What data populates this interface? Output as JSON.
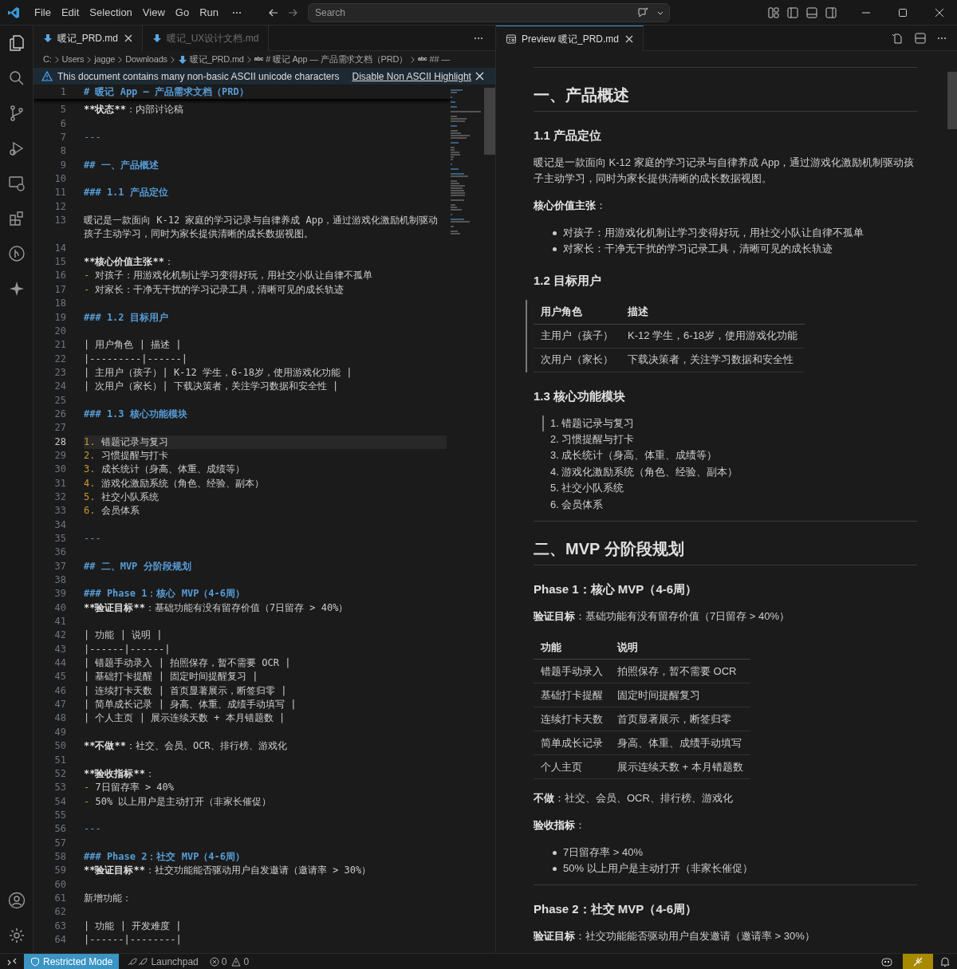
{
  "window": {
    "menu": [
      "File",
      "Edit",
      "Selection",
      "View",
      "Go",
      "Run"
    ],
    "search": {
      "placeholder": "Search"
    }
  },
  "left_group": {
    "tabs": [
      {
        "label": "暖记_PRD.md",
        "selected": true
      },
      {
        "label": "暖记_UX设计文档.md",
        "selected": false
      }
    ],
    "breadcrumbs": [
      {
        "text": "C:",
        "kind": "folder"
      },
      {
        "text": "Users",
        "kind": "folder"
      },
      {
        "text": "jagge",
        "kind": "folder"
      },
      {
        "text": "Downloads",
        "kind": "folder"
      },
      {
        "text": "暖记_PRD.md",
        "kind": "file"
      },
      {
        "text": "# 暖记 App — 产品需求文档（PRD）",
        "kind": "symbol",
        "icon_text": "abc"
      },
      {
        "text": "## —",
        "kind": "symbol",
        "icon_text": "abc"
      }
    ],
    "banner": {
      "message": "This document contains many non-basic ASCII unicode characters",
      "action": "Disable Non ASCII Highlight"
    },
    "lines": [
      {
        "n": "1",
        "kind": "heading",
        "text": "# 暖记 App — 产品需求文档（PRD）",
        "current": false
      },
      {
        "n": "5",
        "kind": "strong",
        "lead": "**状态**",
        "text": "：内部讨论稿",
        "current": false
      },
      {
        "n": "6",
        "kind": "blank",
        "current": false
      },
      {
        "n": "7",
        "kind": "hr",
        "text": "---",
        "current": false
      },
      {
        "n": "8",
        "kind": "blank",
        "current": false
      },
      {
        "n": "9",
        "kind": "heading",
        "text": "## 一、产品概述",
        "current": false
      },
      {
        "n": "10",
        "kind": "blank",
        "current": false
      },
      {
        "n": "11",
        "kind": "heading",
        "text": "### 1.1 产品定位",
        "current": false
      },
      {
        "n": "12",
        "kind": "blank",
        "current": false
      },
      {
        "n": "13",
        "kind": "text",
        "text": "暖记是一款面向 K-12 家庭的学习记录与自律养成 App，通过游戏化激励机制驱动孩子主动学习，同时为家长提供清晰的成长数据视图。",
        "current": false
      },
      {
        "n": "14",
        "kind": "blank",
        "current": false
      },
      {
        "n": "15",
        "kind": "strong",
        "lead": "**核心价值主张**",
        "text": "：",
        "current": false
      },
      {
        "n": "16",
        "kind": "list",
        "marker": "-",
        "text": "对孩子：用游戏化机制让学习变得好玩，用社交小队让自律不孤单",
        "current": false
      },
      {
        "n": "17",
        "kind": "list",
        "marker": "-",
        "text": "对家长：干净无干扰的学习记录工具，清晰可见的成长轨迹",
        "current": false
      },
      {
        "n": "18",
        "kind": "blank",
        "current": false
      },
      {
        "n": "19",
        "kind": "heading",
        "text": "### 1.2 目标用户",
        "current": false
      },
      {
        "n": "20",
        "kind": "blank",
        "current": false
      },
      {
        "n": "21",
        "kind": "text",
        "text": "| 用户角色 | 描述 |",
        "current": false
      },
      {
        "n": "22",
        "kind": "text",
        "text": "|---------|------|",
        "current": false
      },
      {
        "n": "23",
        "kind": "text",
        "text": "| 主用户（孩子）| K-12 学生，6-18岁，使用游戏化功能 |",
        "current": false
      },
      {
        "n": "24",
        "kind": "text",
        "text": "| 次用户（家长）| 下载决策者，关注学习数据和安全性 |",
        "current": false
      },
      {
        "n": "25",
        "kind": "blank",
        "current": false
      },
      {
        "n": "26",
        "kind": "heading",
        "text": "### 1.3 核心功能模块",
        "current": false
      },
      {
        "n": "27",
        "kind": "blank",
        "current": false
      },
      {
        "n": "28",
        "kind": "list",
        "marker": "1.",
        "text": "错题记录与复习",
        "current": true
      },
      {
        "n": "29",
        "kind": "list",
        "marker": "2.",
        "text": "习惯提醒与打卡",
        "current": false
      },
      {
        "n": "30",
        "kind": "list",
        "marker": "3.",
        "text": "成长统计（身高、体重、成绩等）",
        "current": false
      },
      {
        "n": "31",
        "kind": "list",
        "marker": "4.",
        "text": "游戏化激励系统（角色、经验、副本）",
        "current": false
      },
      {
        "n": "32",
        "kind": "list",
        "marker": "5.",
        "text": "社交小队系统",
        "current": false
      },
      {
        "n": "33",
        "kind": "list",
        "marker": "6.",
        "text": "会员体系",
        "current": false
      },
      {
        "n": "34",
        "kind": "blank",
        "current": false
      },
      {
        "n": "35",
        "kind": "hr",
        "text": "---",
        "current": false
      },
      {
        "n": "36",
        "kind": "blank",
        "current": false
      },
      {
        "n": "37",
        "kind": "heading",
        "text": "## 二、MVP 分阶段规划",
        "current": false
      },
      {
        "n": "38",
        "kind": "blank",
        "current": false
      },
      {
        "n": "39",
        "kind": "heading",
        "text": "### Phase 1：核心 MVP（4-6周）",
        "current": false
      },
      {
        "n": "40",
        "kind": "strong",
        "lead": "**验证目标**",
        "text": "：基础功能有没有留存价值（7日留存 > 40%）",
        "current": false
      },
      {
        "n": "41",
        "kind": "blank",
        "current": false
      },
      {
        "n": "42",
        "kind": "text",
        "text": "| 功能 | 说明 |",
        "current": false
      },
      {
        "n": "43",
        "kind": "text",
        "text": "|------|------|",
        "current": false
      },
      {
        "n": "44",
        "kind": "text",
        "text": "| 错题手动录入 | 拍照保存，暂不需要 OCR |",
        "current": false
      },
      {
        "n": "45",
        "kind": "text",
        "text": "| 基础打卡提醒 | 固定时间提醒复习 |",
        "current": false
      },
      {
        "n": "46",
        "kind": "text",
        "text": "| 连续打卡天数 | 首页显著展示，断签归零 |",
        "current": false
      },
      {
        "n": "47",
        "kind": "text",
        "text": "| 简单成长记录 | 身高、体重、成绩手动填写 |",
        "current": false
      },
      {
        "n": "48",
        "kind": "text",
        "text": "| 个人主页 | 展示连续天数 + 本月错题数 |",
        "current": false
      },
      {
        "n": "49",
        "kind": "blank",
        "current": false
      },
      {
        "n": "50",
        "kind": "strong",
        "lead": "**不做**",
        "text": "：社交、会员、OCR、排行榜、游戏化",
        "current": false
      },
      {
        "n": "51",
        "kind": "blank",
        "current": false
      },
      {
        "n": "52",
        "kind": "strong",
        "lead": "**验收指标**",
        "text": "：",
        "current": false
      },
      {
        "n": "53",
        "kind": "list",
        "marker": "-",
        "text": "7日留存率 > 40%",
        "current": false
      },
      {
        "n": "54",
        "kind": "list",
        "marker": "-",
        "text": "50% 以上用户是主动打开（非家长催促）",
        "current": false
      },
      {
        "n": "55",
        "kind": "blank",
        "current": false
      },
      {
        "n": "56",
        "kind": "hr",
        "text": "---",
        "current": false
      },
      {
        "n": "57",
        "kind": "blank",
        "current": false
      },
      {
        "n": "58",
        "kind": "heading",
        "text": "### Phase 2：社交 MVP（4-6周）",
        "current": false
      },
      {
        "n": "59",
        "kind": "strong",
        "lead": "**验证目标**",
        "text": "：社交功能能否驱动用户自发邀请（邀请率 > 30%）",
        "current": false
      },
      {
        "n": "60",
        "kind": "blank",
        "current": false
      },
      {
        "n": "61",
        "kind": "text",
        "text": "新增功能：",
        "current": false
      },
      {
        "n": "62",
        "kind": "blank",
        "current": false
      },
      {
        "n": "63",
        "kind": "text",
        "text": "| 功能 | 开发难度 |",
        "current": false
      },
      {
        "n": "64",
        "kind": "text",
        "text": "|------|--------|",
        "current": false
      }
    ]
  },
  "right_group": {
    "tabs": [
      {
        "label": "Preview 暖记_PRD.md",
        "selected": true
      }
    ],
    "blocks": [
      {
        "kind": "hr",
        "active": false
      },
      {
        "kind": "h1",
        "text": "一、产品概述",
        "active": false
      },
      {
        "kind": "h3",
        "text": "1.1 产品定位",
        "active": false
      },
      {
        "kind": "p",
        "text": "暖记是一款面向 K-12 家庭的学习记录与自律养成 App，通过游戏化激励机制驱动孩子主动学习，同时为家长提供清晰的成长数据视图。",
        "active": false
      },
      {
        "kind": "p",
        "text": "**核心价值主张**：",
        "active": false
      },
      {
        "kind": "ul",
        "active": false,
        "items": [
          {
            "text": "对孩子：用游戏化机制让学习变得好玩，用社交小队让自律不孤单",
            "active": false
          },
          {
            "text": "对家长：干净无干扰的学习记录工具，清晰可见的成长轨迹",
            "active": false
          }
        ]
      },
      {
        "kind": "h3",
        "text": "1.2 目标用户",
        "active": false
      },
      {
        "kind": "table",
        "active": true,
        "columns": [
          "用户角色",
          "描述"
        ],
        "rows": [
          [
            "主用户（孩子）",
            "K-12 学生，6-18岁，使用游戏化功能"
          ],
          [
            "次用户（家长）",
            "下载决策者，关注学习数据和安全性"
          ]
        ]
      },
      {
        "kind": "h3",
        "text": "1.3 核心功能模块",
        "active": false
      },
      {
        "kind": "ol",
        "active": false,
        "items": [
          {
            "marker": "1.",
            "text": "错题记录与复习",
            "active": true
          },
          {
            "marker": "2.",
            "text": "习惯提醒与打卡",
            "active": false
          },
          {
            "marker": "3.",
            "text": "成长统计（身高、体重、成绩等）",
            "active": false
          },
          {
            "marker": "4.",
            "text": "游戏化激励系统（角色、经验、副本）",
            "active": false
          },
          {
            "marker": "5.",
            "text": "社交小队系统",
            "active": false
          },
          {
            "marker": "6.",
            "text": "会员体系",
            "active": false
          }
        ]
      },
      {
        "kind": "hr",
        "active": false
      },
      {
        "kind": "h1",
        "text": "二、MVP 分阶段规划",
        "active": false
      },
      {
        "kind": "h3",
        "text": "Phase 1：核心 MVP（4-6周）",
        "active": false
      },
      {
        "kind": "p",
        "text": "**验证目标**：基础功能有没有留存价值（7日留存 > 40%）",
        "active": false
      },
      {
        "kind": "table",
        "active": false,
        "columns": [
          "功能",
          "说明"
        ],
        "rows": [
          [
            "错题手动录入",
            "拍照保存，暂不需要 OCR"
          ],
          [
            "基础打卡提醒",
            "固定时间提醒复习"
          ],
          [
            "连续打卡天数",
            "首页显著展示，断签归零"
          ],
          [
            "简单成长记录",
            "身高、体重、成绩手动填写"
          ],
          [
            "个人主页",
            "展示连续天数 + 本月错题数"
          ]
        ]
      },
      {
        "kind": "p",
        "text": "**不做**：社交、会员、OCR、排行榜、游戏化",
        "active": false
      },
      {
        "kind": "p",
        "text": "**验收指标**：",
        "active": false
      },
      {
        "kind": "ul",
        "active": false,
        "items": [
          {
            "text": "7日留存率 > 40%",
            "active": false
          },
          {
            "text": "50% 以上用户是主动打开（非家长催促）",
            "active": false
          }
        ]
      },
      {
        "kind": "hr",
        "active": false
      },
      {
        "kind": "h3",
        "text": "Phase 2：社交 MVP（4-6周）",
        "active": false
      },
      {
        "kind": "p",
        "text": "**验证目标**：社交功能能否驱动用户自发邀请（邀请率 > 30%）",
        "active": false
      }
    ]
  },
  "status_bar": {
    "mode": "Restricted Mode",
    "launchpad": "Launchpad",
    "errors": "0",
    "warnings": "0"
  }
}
